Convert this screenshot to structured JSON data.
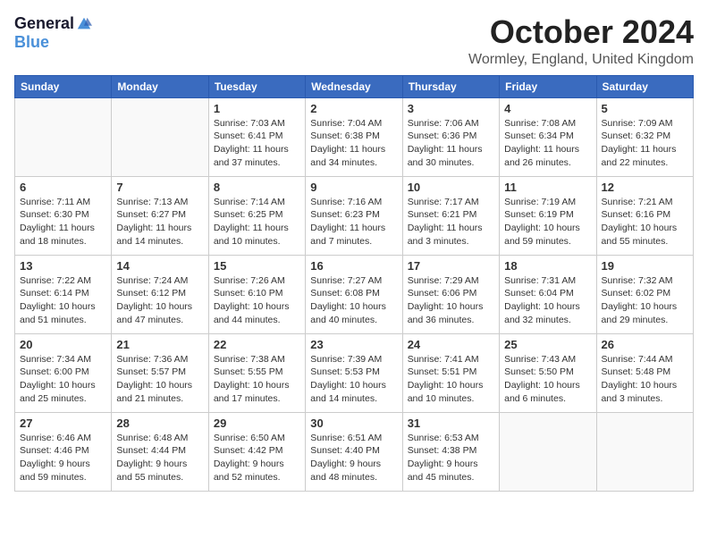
{
  "logo": {
    "general": "General",
    "blue": "Blue"
  },
  "header": {
    "month": "October 2024",
    "location": "Wormley, England, United Kingdom"
  },
  "weekdays": [
    "Sunday",
    "Monday",
    "Tuesday",
    "Wednesday",
    "Thursday",
    "Friday",
    "Saturday"
  ],
  "weeks": [
    [
      {
        "day": "",
        "info": ""
      },
      {
        "day": "",
        "info": ""
      },
      {
        "day": "1",
        "info": "Sunrise: 7:03 AM\nSunset: 6:41 PM\nDaylight: 11 hours and 37 minutes."
      },
      {
        "day": "2",
        "info": "Sunrise: 7:04 AM\nSunset: 6:38 PM\nDaylight: 11 hours and 34 minutes."
      },
      {
        "day": "3",
        "info": "Sunrise: 7:06 AM\nSunset: 6:36 PM\nDaylight: 11 hours and 30 minutes."
      },
      {
        "day": "4",
        "info": "Sunrise: 7:08 AM\nSunset: 6:34 PM\nDaylight: 11 hours and 26 minutes."
      },
      {
        "day": "5",
        "info": "Sunrise: 7:09 AM\nSunset: 6:32 PM\nDaylight: 11 hours and 22 minutes."
      }
    ],
    [
      {
        "day": "6",
        "info": "Sunrise: 7:11 AM\nSunset: 6:30 PM\nDaylight: 11 hours and 18 minutes."
      },
      {
        "day": "7",
        "info": "Sunrise: 7:13 AM\nSunset: 6:27 PM\nDaylight: 11 hours and 14 minutes."
      },
      {
        "day": "8",
        "info": "Sunrise: 7:14 AM\nSunset: 6:25 PM\nDaylight: 11 hours and 10 minutes."
      },
      {
        "day": "9",
        "info": "Sunrise: 7:16 AM\nSunset: 6:23 PM\nDaylight: 11 hours and 7 minutes."
      },
      {
        "day": "10",
        "info": "Sunrise: 7:17 AM\nSunset: 6:21 PM\nDaylight: 11 hours and 3 minutes."
      },
      {
        "day": "11",
        "info": "Sunrise: 7:19 AM\nSunset: 6:19 PM\nDaylight: 10 hours and 59 minutes."
      },
      {
        "day": "12",
        "info": "Sunrise: 7:21 AM\nSunset: 6:16 PM\nDaylight: 10 hours and 55 minutes."
      }
    ],
    [
      {
        "day": "13",
        "info": "Sunrise: 7:22 AM\nSunset: 6:14 PM\nDaylight: 10 hours and 51 minutes."
      },
      {
        "day": "14",
        "info": "Sunrise: 7:24 AM\nSunset: 6:12 PM\nDaylight: 10 hours and 47 minutes."
      },
      {
        "day": "15",
        "info": "Sunrise: 7:26 AM\nSunset: 6:10 PM\nDaylight: 10 hours and 44 minutes."
      },
      {
        "day": "16",
        "info": "Sunrise: 7:27 AM\nSunset: 6:08 PM\nDaylight: 10 hours and 40 minutes."
      },
      {
        "day": "17",
        "info": "Sunrise: 7:29 AM\nSunset: 6:06 PM\nDaylight: 10 hours and 36 minutes."
      },
      {
        "day": "18",
        "info": "Sunrise: 7:31 AM\nSunset: 6:04 PM\nDaylight: 10 hours and 32 minutes."
      },
      {
        "day": "19",
        "info": "Sunrise: 7:32 AM\nSunset: 6:02 PM\nDaylight: 10 hours and 29 minutes."
      }
    ],
    [
      {
        "day": "20",
        "info": "Sunrise: 7:34 AM\nSunset: 6:00 PM\nDaylight: 10 hours and 25 minutes."
      },
      {
        "day": "21",
        "info": "Sunrise: 7:36 AM\nSunset: 5:57 PM\nDaylight: 10 hours and 21 minutes."
      },
      {
        "day": "22",
        "info": "Sunrise: 7:38 AM\nSunset: 5:55 PM\nDaylight: 10 hours and 17 minutes."
      },
      {
        "day": "23",
        "info": "Sunrise: 7:39 AM\nSunset: 5:53 PM\nDaylight: 10 hours and 14 minutes."
      },
      {
        "day": "24",
        "info": "Sunrise: 7:41 AM\nSunset: 5:51 PM\nDaylight: 10 hours and 10 minutes."
      },
      {
        "day": "25",
        "info": "Sunrise: 7:43 AM\nSunset: 5:50 PM\nDaylight: 10 hours and 6 minutes."
      },
      {
        "day": "26",
        "info": "Sunrise: 7:44 AM\nSunset: 5:48 PM\nDaylight: 10 hours and 3 minutes."
      }
    ],
    [
      {
        "day": "27",
        "info": "Sunrise: 6:46 AM\nSunset: 4:46 PM\nDaylight: 9 hours and 59 minutes."
      },
      {
        "day": "28",
        "info": "Sunrise: 6:48 AM\nSunset: 4:44 PM\nDaylight: 9 hours and 55 minutes."
      },
      {
        "day": "29",
        "info": "Sunrise: 6:50 AM\nSunset: 4:42 PM\nDaylight: 9 hours and 52 minutes."
      },
      {
        "day": "30",
        "info": "Sunrise: 6:51 AM\nSunset: 4:40 PM\nDaylight: 9 hours and 48 minutes."
      },
      {
        "day": "31",
        "info": "Sunrise: 6:53 AM\nSunset: 4:38 PM\nDaylight: 9 hours and 45 minutes."
      },
      {
        "day": "",
        "info": ""
      },
      {
        "day": "",
        "info": ""
      }
    ]
  ]
}
